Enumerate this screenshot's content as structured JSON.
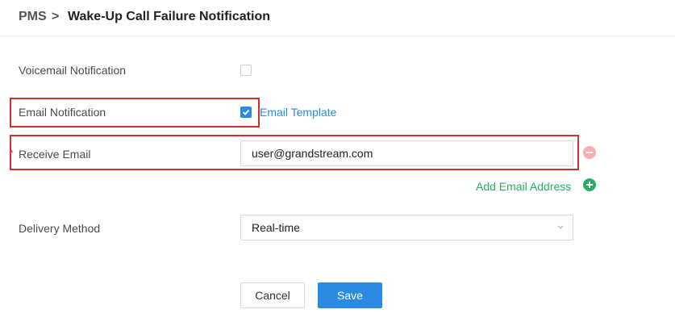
{
  "breadcrumb": {
    "root": "PMS",
    "separator": ">",
    "title": "Wake-Up Call Failure Notification"
  },
  "form": {
    "voicemail_notification": {
      "label": "Voicemail Notification",
      "checked": false
    },
    "email_notification": {
      "label": "Email Notification",
      "checked": true,
      "template_link": "Email Template"
    },
    "receive_email": {
      "required_mark": "*",
      "label": "Receive Email",
      "value": "user@grandstream.com"
    },
    "add_email_link": "Add Email Address",
    "delivery_method": {
      "label": "Delivery Method",
      "value": "Real-time"
    }
  },
  "actions": {
    "cancel_label": "Cancel",
    "save_label": "Save"
  },
  "icons": {
    "checkbox_check": "check-icon",
    "remove": "minus-circle-icon",
    "add": "plus-circle-icon",
    "select_arrow": "chevron-down-icon"
  },
  "colors": {
    "accent": "#2b8ae2",
    "add_green": "#27ae60",
    "highlight_red": "#d32f2f",
    "remove_pink": "#f7b0b0"
  }
}
